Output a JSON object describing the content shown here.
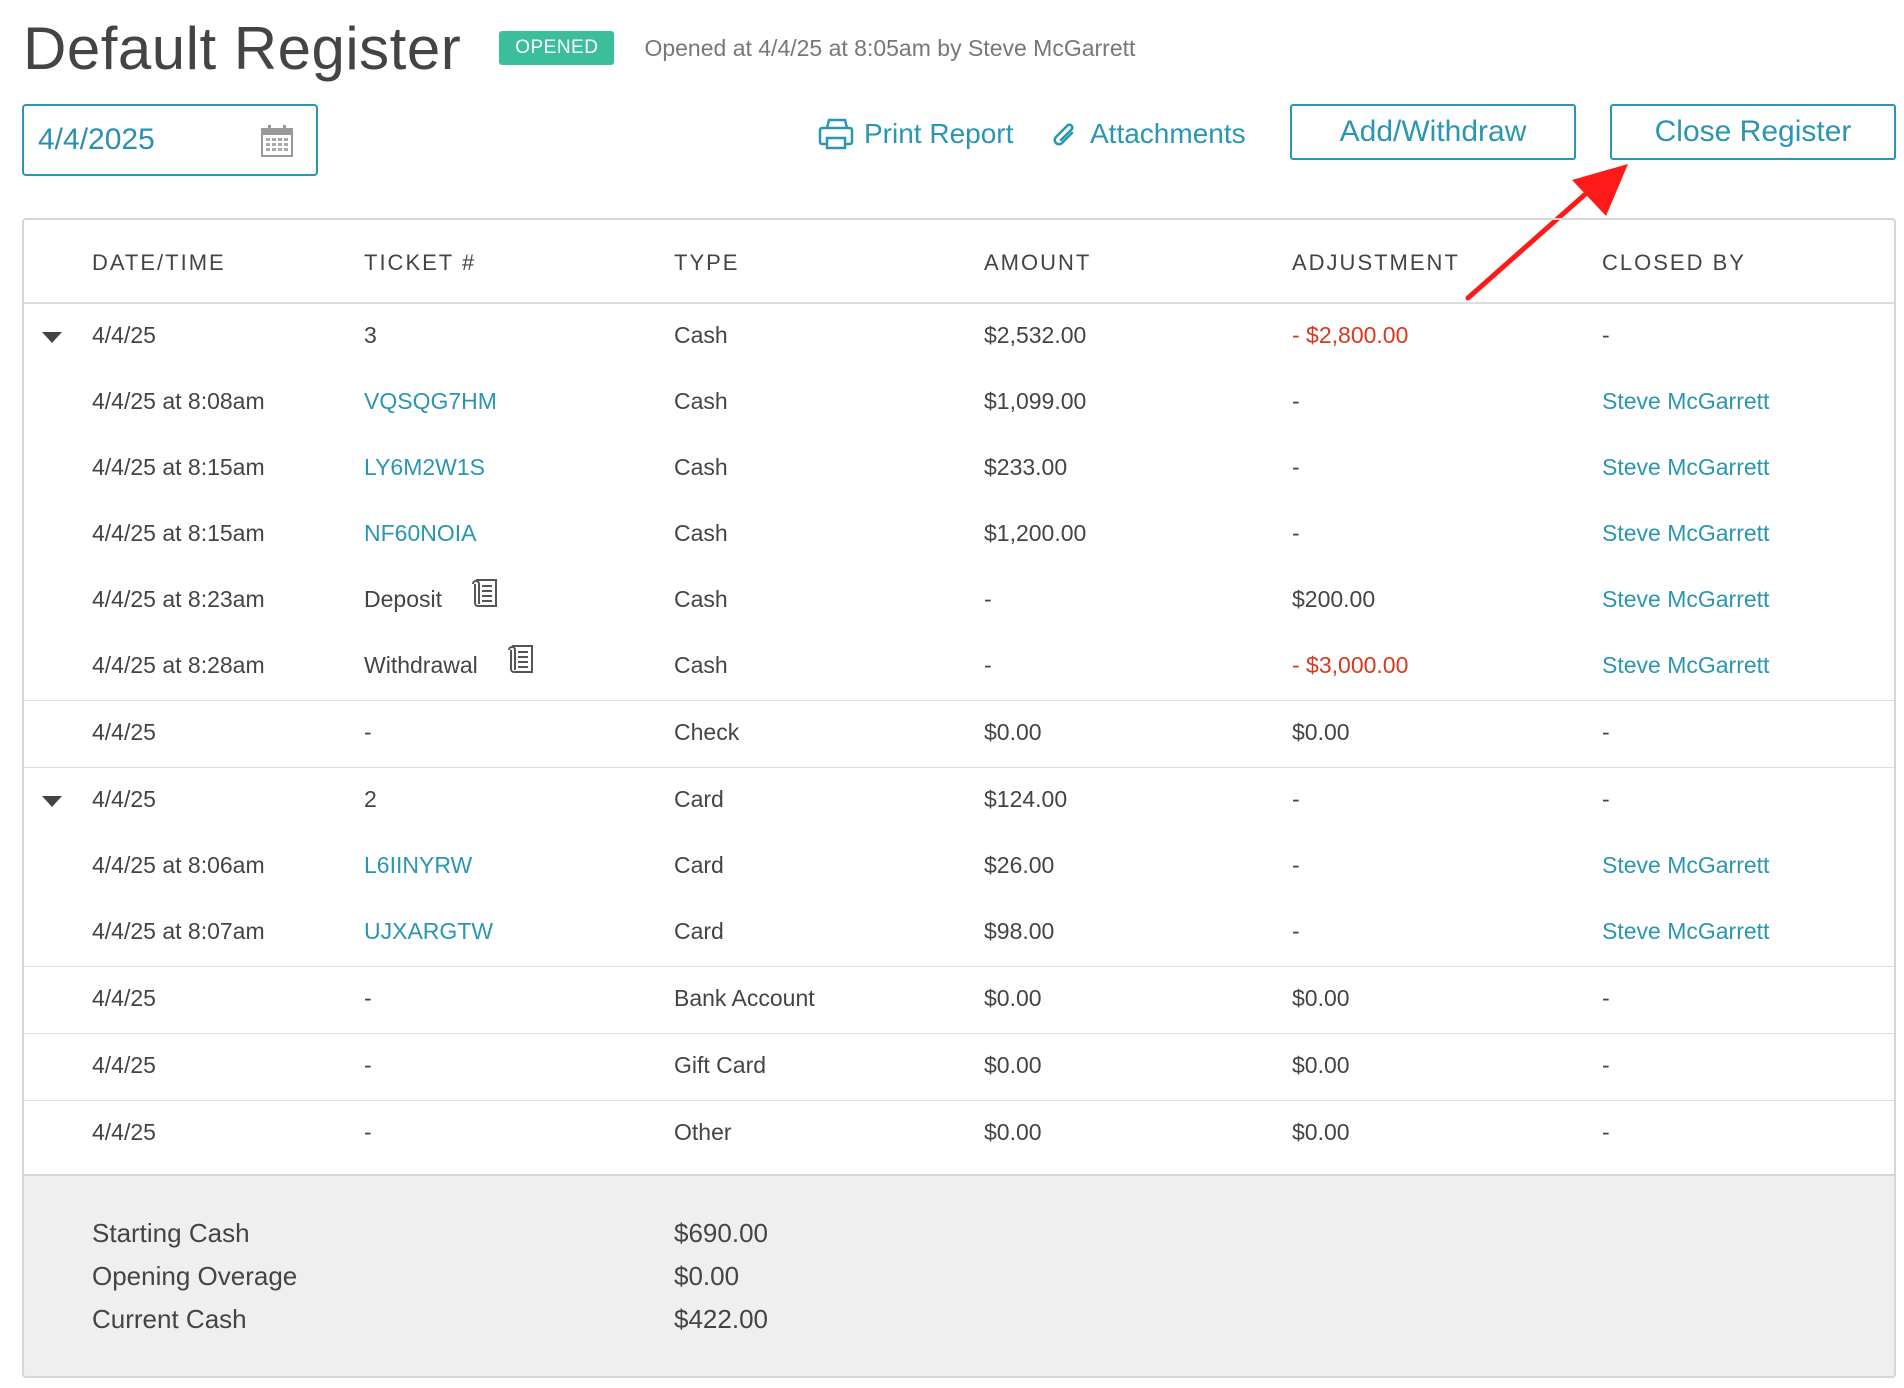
{
  "header": {
    "title": "Default Register",
    "badge": "OPENED",
    "opened_text": "Opened at 4/4/25 at 8:05am by Steve McGarrett"
  },
  "toolbar": {
    "date_value": "4/4/2025",
    "print_label": "Print Report",
    "attachments_label": "Attachments",
    "add_withdraw_label": "Add/Withdraw",
    "close_register_label": "Close Register",
    "annotation_arrow_color": "#ff1a1a"
  },
  "table": {
    "columns": [
      "DATE/TIME",
      "TICKET #",
      "TYPE",
      "AMOUNT",
      "ADJUSTMENT",
      "CLOSED BY"
    ],
    "rows": [
      {
        "date": "4/4/25",
        "ticket": "3",
        "type": "Cash",
        "amount": "$2,532.00",
        "adjustment": "- $2,800.00",
        "closed_by": "-"
      },
      {
        "date": "4/4/25 at 8:08am",
        "ticket": "VQSQG7HM",
        "type": "Cash",
        "amount": "$1,099.00",
        "adjustment": "-",
        "closed_by": "Steve McGarrett"
      },
      {
        "date": "4/4/25 at 8:15am",
        "ticket": "LY6M2W1S",
        "type": "Cash",
        "amount": "$233.00",
        "adjustment": "-",
        "closed_by": "Steve McGarrett"
      },
      {
        "date": "4/4/25 at 8:15am",
        "ticket": "NF60NOIA",
        "type": "Cash",
        "amount": "$1,200.00",
        "adjustment": "-",
        "closed_by": "Steve McGarrett"
      },
      {
        "date": "4/4/25 at 8:23am",
        "ticket": "Deposit",
        "type": "Cash",
        "amount": "-",
        "adjustment": "$200.00",
        "closed_by": "Steve McGarrett"
      },
      {
        "date": "4/4/25 at 8:28am",
        "ticket": "Withdrawal",
        "type": "Cash",
        "amount": "-",
        "adjustment": "- $3,000.00",
        "closed_by": "Steve McGarrett"
      },
      {
        "date": "4/4/25",
        "ticket": "-",
        "type": "Check",
        "amount": "$0.00",
        "adjustment": "$0.00",
        "closed_by": "-"
      },
      {
        "date": "4/4/25",
        "ticket": "2",
        "type": "Card",
        "amount": "$124.00",
        "adjustment": "-",
        "closed_by": "-"
      },
      {
        "date": "4/4/25 at 8:06am",
        "ticket": "L6IINYRW",
        "type": "Card",
        "amount": "$26.00",
        "adjustment": "-",
        "closed_by": "Steve McGarrett"
      },
      {
        "date": "4/4/25 at 8:07am",
        "ticket": "UJXARGTW",
        "type": "Card",
        "amount": "$98.00",
        "adjustment": "-",
        "closed_by": "Steve McGarrett"
      },
      {
        "date": "4/4/25",
        "ticket": "-",
        "type": "Bank Account",
        "amount": "$0.00",
        "adjustment": "$0.00",
        "closed_by": "-"
      },
      {
        "date": "4/4/25",
        "ticket": "-",
        "type": "Gift Card",
        "amount": "$0.00",
        "adjustment": "$0.00",
        "closed_by": "-"
      },
      {
        "date": "4/4/25",
        "ticket": "-",
        "type": "Other",
        "amount": "$0.00",
        "adjustment": "$0.00",
        "closed_by": "-"
      }
    ]
  },
  "summary": {
    "starting_cash_label": "Starting Cash",
    "starting_cash_value": "$690.00",
    "opening_overage_label": "Opening Overage",
    "opening_overage_value": "$0.00",
    "current_cash_label": "Current Cash",
    "current_cash_value": "$422.00"
  },
  "colors": {
    "accent": "#2a96b0",
    "badge": "#3bbf9a",
    "negative": "#d9381e"
  }
}
